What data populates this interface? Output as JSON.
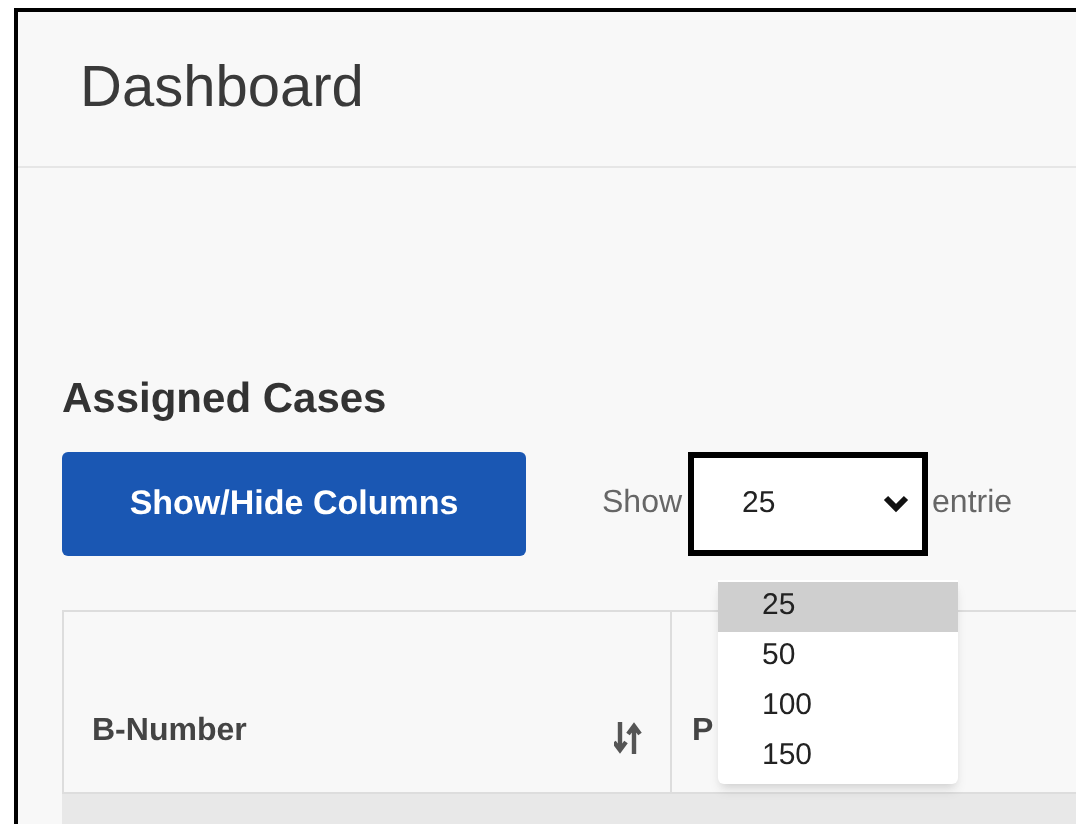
{
  "page_title": "Dashboard",
  "section_title": "Assigned Cases",
  "columns_button": "Show/Hide Columns",
  "entries_control": {
    "prefix": "Show",
    "value": "25",
    "suffix": "entrie",
    "expanded": true,
    "options": [
      {
        "label": "25",
        "selected": true
      },
      {
        "label": "50",
        "selected": false
      },
      {
        "label": "100",
        "selected": false
      },
      {
        "label": "150",
        "selected": false
      }
    ]
  },
  "table": {
    "columns": [
      {
        "label": "B-Number",
        "sortable": true
      },
      {
        "label": "P",
        "sortable": false
      }
    ]
  }
}
